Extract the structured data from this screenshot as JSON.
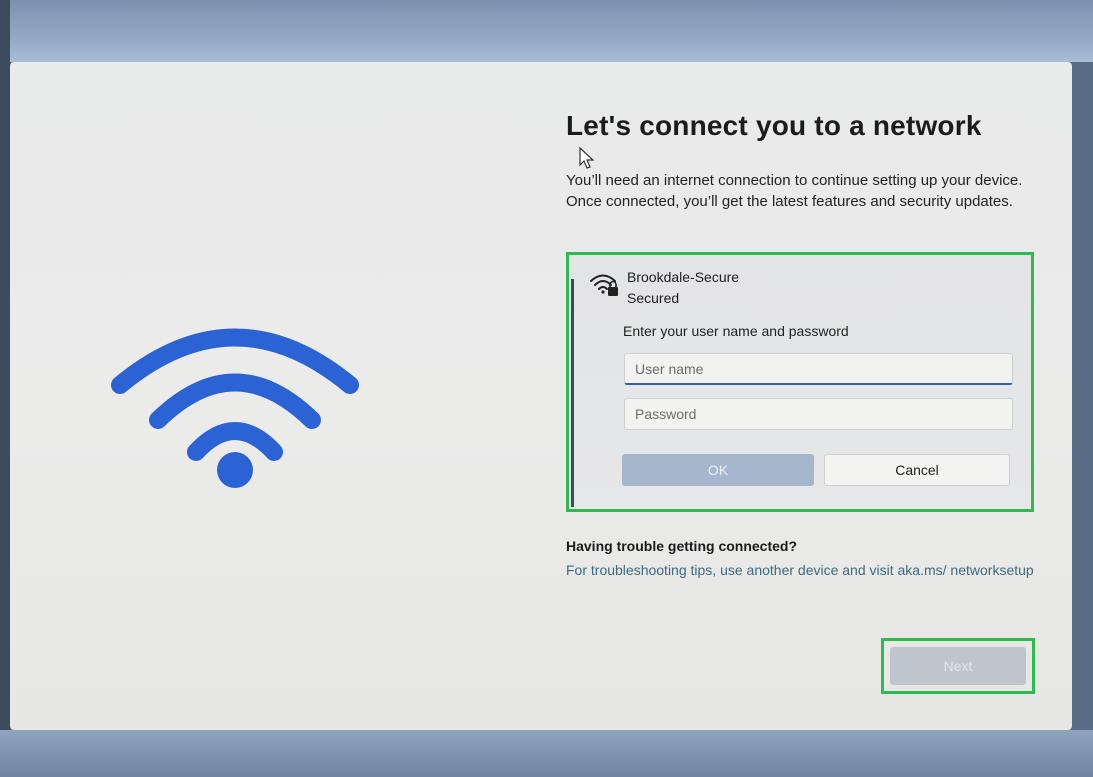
{
  "page": {
    "title": "Let's connect you to a network",
    "description": "You’ll need an internet connection to continue setting up your device. Once connected, you’ll get the latest features and security updates."
  },
  "network": {
    "name": "Brookdale-Secure",
    "status": "Secured",
    "icon": "wifi-secured-icon",
    "prompt": "Enter your user name and password",
    "username_placeholder": "User name",
    "password_placeholder": "Password",
    "ok_label": "OK",
    "cancel_label": "Cancel"
  },
  "help": {
    "heading": "Having trouble getting connected?",
    "text": "For troubleshooting tips, use another device and visit aka.ms/ networksetup"
  },
  "footer": {
    "next_label": "Next"
  },
  "colors": {
    "wifi_art": "#2b63d4",
    "highlight": "#2dbb4e"
  }
}
